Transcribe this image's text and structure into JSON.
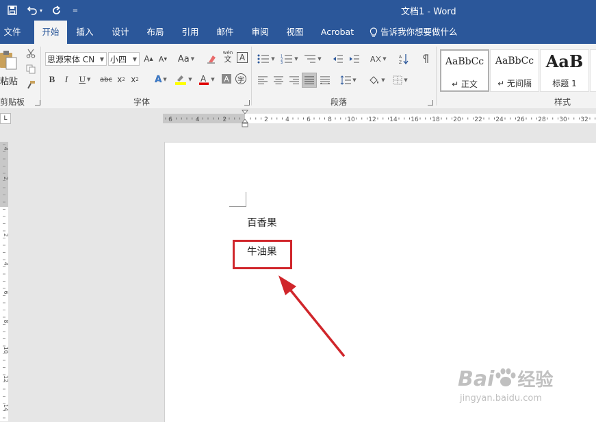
{
  "window": {
    "title": "文档1  -  Word"
  },
  "quick_access": {
    "undo_dd": "▾",
    "customize": "="
  },
  "tabs": [
    "文件",
    "开始",
    "插入",
    "设计",
    "布局",
    "引用",
    "邮件",
    "审阅",
    "视图",
    "Acrobat",
    "告诉我你想要做什么"
  ],
  "clipboard": {
    "paste": "粘贴",
    "group": "剪贴板"
  },
  "font": {
    "name": "思源宋体 CN",
    "size": "小四",
    "change_case": "Aa",
    "wen": "wén",
    "wen_char": "文",
    "group": "字体"
  },
  "paragraph": {
    "group": "段落"
  },
  "styles": {
    "items": [
      {
        "sample": "AaBbCc",
        "name": "↵ 正文"
      },
      {
        "sample": "AaBbCc",
        "name": "↵ 无间隔"
      },
      {
        "sample": "AaB",
        "name": "标题 1"
      }
    ],
    "group": "样式"
  },
  "ruler": {
    "h_left": [
      "6",
      "4",
      "2"
    ],
    "h_right": [
      "2",
      "4",
      "6",
      "8",
      "10",
      "12",
      "14",
      "16",
      "18",
      "20",
      "22",
      "24",
      "26",
      "28",
      "30",
      "32"
    ],
    "v_top": [
      "4",
      "2"
    ],
    "v_body": [
      "2",
      "4",
      "6",
      "8",
      "10",
      "12",
      "14"
    ]
  },
  "document": {
    "paragraphs": [
      "百香果",
      "牛油果"
    ]
  },
  "watermark": {
    "brand": "Bai",
    "brand_jp": "经验",
    "url": "jingyan.baidu.com"
  },
  "colors": {
    "title_bar": "#2b579a",
    "highlight": "#d0262b",
    "arrow": "#d0262b"
  }
}
